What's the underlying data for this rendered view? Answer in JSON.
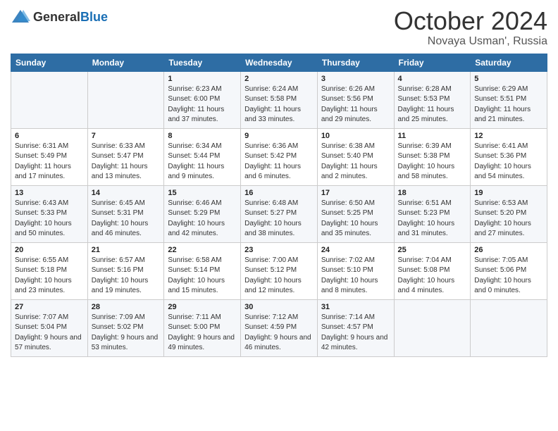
{
  "header": {
    "logo_general": "General",
    "logo_blue": "Blue",
    "month": "October 2024",
    "location": "Novaya Usman', Russia"
  },
  "weekdays": [
    "Sunday",
    "Monday",
    "Tuesday",
    "Wednesday",
    "Thursday",
    "Friday",
    "Saturday"
  ],
  "weeks": [
    [
      {
        "day": "",
        "sunrise": "",
        "sunset": "",
        "daylight": ""
      },
      {
        "day": "",
        "sunrise": "",
        "sunset": "",
        "daylight": ""
      },
      {
        "day": "1",
        "sunrise": "Sunrise: 6:23 AM",
        "sunset": "Sunset: 6:00 PM",
        "daylight": "Daylight: 11 hours and 37 minutes."
      },
      {
        "day": "2",
        "sunrise": "Sunrise: 6:24 AM",
        "sunset": "Sunset: 5:58 PM",
        "daylight": "Daylight: 11 hours and 33 minutes."
      },
      {
        "day": "3",
        "sunrise": "Sunrise: 6:26 AM",
        "sunset": "Sunset: 5:56 PM",
        "daylight": "Daylight: 11 hours and 29 minutes."
      },
      {
        "day": "4",
        "sunrise": "Sunrise: 6:28 AM",
        "sunset": "Sunset: 5:53 PM",
        "daylight": "Daylight: 11 hours and 25 minutes."
      },
      {
        "day": "5",
        "sunrise": "Sunrise: 6:29 AM",
        "sunset": "Sunset: 5:51 PM",
        "daylight": "Daylight: 11 hours and 21 minutes."
      }
    ],
    [
      {
        "day": "6",
        "sunrise": "Sunrise: 6:31 AM",
        "sunset": "Sunset: 5:49 PM",
        "daylight": "Daylight: 11 hours and 17 minutes."
      },
      {
        "day": "7",
        "sunrise": "Sunrise: 6:33 AM",
        "sunset": "Sunset: 5:47 PM",
        "daylight": "Daylight: 11 hours and 13 minutes."
      },
      {
        "day": "8",
        "sunrise": "Sunrise: 6:34 AM",
        "sunset": "Sunset: 5:44 PM",
        "daylight": "Daylight: 11 hours and 9 minutes."
      },
      {
        "day": "9",
        "sunrise": "Sunrise: 6:36 AM",
        "sunset": "Sunset: 5:42 PM",
        "daylight": "Daylight: 11 hours and 6 minutes."
      },
      {
        "day": "10",
        "sunrise": "Sunrise: 6:38 AM",
        "sunset": "Sunset: 5:40 PM",
        "daylight": "Daylight: 11 hours and 2 minutes."
      },
      {
        "day": "11",
        "sunrise": "Sunrise: 6:39 AM",
        "sunset": "Sunset: 5:38 PM",
        "daylight": "Daylight: 10 hours and 58 minutes."
      },
      {
        "day": "12",
        "sunrise": "Sunrise: 6:41 AM",
        "sunset": "Sunset: 5:36 PM",
        "daylight": "Daylight: 10 hours and 54 minutes."
      }
    ],
    [
      {
        "day": "13",
        "sunrise": "Sunrise: 6:43 AM",
        "sunset": "Sunset: 5:33 PM",
        "daylight": "Daylight: 10 hours and 50 minutes."
      },
      {
        "day": "14",
        "sunrise": "Sunrise: 6:45 AM",
        "sunset": "Sunset: 5:31 PM",
        "daylight": "Daylight: 10 hours and 46 minutes."
      },
      {
        "day": "15",
        "sunrise": "Sunrise: 6:46 AM",
        "sunset": "Sunset: 5:29 PM",
        "daylight": "Daylight: 10 hours and 42 minutes."
      },
      {
        "day": "16",
        "sunrise": "Sunrise: 6:48 AM",
        "sunset": "Sunset: 5:27 PM",
        "daylight": "Daylight: 10 hours and 38 minutes."
      },
      {
        "day": "17",
        "sunrise": "Sunrise: 6:50 AM",
        "sunset": "Sunset: 5:25 PM",
        "daylight": "Daylight: 10 hours and 35 minutes."
      },
      {
        "day": "18",
        "sunrise": "Sunrise: 6:51 AM",
        "sunset": "Sunset: 5:23 PM",
        "daylight": "Daylight: 10 hours and 31 minutes."
      },
      {
        "day": "19",
        "sunrise": "Sunrise: 6:53 AM",
        "sunset": "Sunset: 5:20 PM",
        "daylight": "Daylight: 10 hours and 27 minutes."
      }
    ],
    [
      {
        "day": "20",
        "sunrise": "Sunrise: 6:55 AM",
        "sunset": "Sunset: 5:18 PM",
        "daylight": "Daylight: 10 hours and 23 minutes."
      },
      {
        "day": "21",
        "sunrise": "Sunrise: 6:57 AM",
        "sunset": "Sunset: 5:16 PM",
        "daylight": "Daylight: 10 hours and 19 minutes."
      },
      {
        "day": "22",
        "sunrise": "Sunrise: 6:58 AM",
        "sunset": "Sunset: 5:14 PM",
        "daylight": "Daylight: 10 hours and 15 minutes."
      },
      {
        "day": "23",
        "sunrise": "Sunrise: 7:00 AM",
        "sunset": "Sunset: 5:12 PM",
        "daylight": "Daylight: 10 hours and 12 minutes."
      },
      {
        "day": "24",
        "sunrise": "Sunrise: 7:02 AM",
        "sunset": "Sunset: 5:10 PM",
        "daylight": "Daylight: 10 hours and 8 minutes."
      },
      {
        "day": "25",
        "sunrise": "Sunrise: 7:04 AM",
        "sunset": "Sunset: 5:08 PM",
        "daylight": "Daylight: 10 hours and 4 minutes."
      },
      {
        "day": "26",
        "sunrise": "Sunrise: 7:05 AM",
        "sunset": "Sunset: 5:06 PM",
        "daylight": "Daylight: 10 hours and 0 minutes."
      }
    ],
    [
      {
        "day": "27",
        "sunrise": "Sunrise: 7:07 AM",
        "sunset": "Sunset: 5:04 PM",
        "daylight": "Daylight: 9 hours and 57 minutes."
      },
      {
        "day": "28",
        "sunrise": "Sunrise: 7:09 AM",
        "sunset": "Sunset: 5:02 PM",
        "daylight": "Daylight: 9 hours and 53 minutes."
      },
      {
        "day": "29",
        "sunrise": "Sunrise: 7:11 AM",
        "sunset": "Sunset: 5:00 PM",
        "daylight": "Daylight: 9 hours and 49 minutes."
      },
      {
        "day": "30",
        "sunrise": "Sunrise: 7:12 AM",
        "sunset": "Sunset: 4:59 PM",
        "daylight": "Daylight: 9 hours and 46 minutes."
      },
      {
        "day": "31",
        "sunrise": "Sunrise: 7:14 AM",
        "sunset": "Sunset: 4:57 PM",
        "daylight": "Daylight: 9 hours and 42 minutes."
      },
      {
        "day": "",
        "sunrise": "",
        "sunset": "",
        "daylight": ""
      },
      {
        "day": "",
        "sunrise": "",
        "sunset": "",
        "daylight": ""
      }
    ]
  ]
}
